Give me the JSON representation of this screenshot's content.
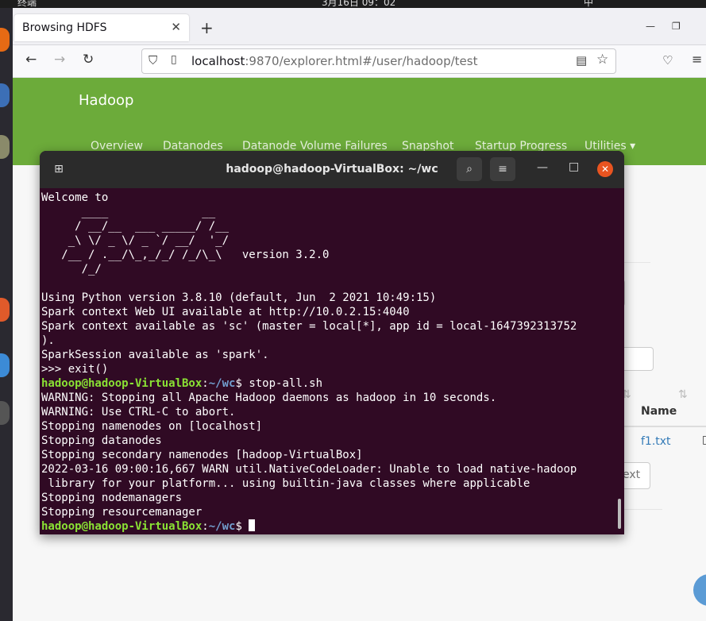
{
  "system": {
    "app_name": "终端",
    "clock": "3月16日 09：02",
    "input_method": "中"
  },
  "browser": {
    "tab_title": "Browsing HDFS",
    "url_host": "localhost",
    "url_rest": ":9870/explorer.html#/user/hadoop/test"
  },
  "hadoop": {
    "brand": "Hadoop",
    "nav": [
      "Overview",
      "Datanodes",
      "Datanode Volume Failures",
      "Snapshot",
      "Startup Progress",
      "Utilities ▾"
    ],
    "table_header": "Name",
    "file_link": "f1.txt",
    "button_partial": "ext"
  },
  "terminal": {
    "title": "hadoop@hadoop-VirtualBox: ~/wc",
    "lines": [
      "Welcome to",
      "      ____              __",
      "     / __/__  ___ _____/ /__",
      "    _\\ \\/ _ \\/ _ `/ __/  '_/",
      "   /__ / .__/\\_,_/_/ /_/\\_\\   version 3.2.0",
      "      /_/",
      "",
      "Using Python version 3.8.10 (default, Jun  2 2021 10:49:15)",
      "Spark context Web UI available at http://10.0.2.15:4040",
      "Spark context available as 'sc' (master = local[*], app id = local-1647392313752",
      ").",
      "SparkSession available as 'spark'.",
      ">>> exit()"
    ],
    "prompt_user": "hadoop@hadoop-VirtualBox",
    "prompt_path": "~/wc",
    "command": "stop-all.sh",
    "output": [
      "WARNING: Stopping all Apache Hadoop daemons as hadoop in 10 seconds.",
      "WARNING: Use CTRL-C to abort.",
      "Stopping namenodes on [localhost]",
      "Stopping datanodes",
      "Stopping secondary namenodes [hadoop-VirtualBox]",
      "2022-03-16 09:00:16,667 WARN util.NativeCodeLoader: Unable to load native-hadoop",
      " library for your platform... using builtin-java classes where applicable",
      "Stopping nodemanagers",
      "Stopping resourcemanager"
    ]
  }
}
